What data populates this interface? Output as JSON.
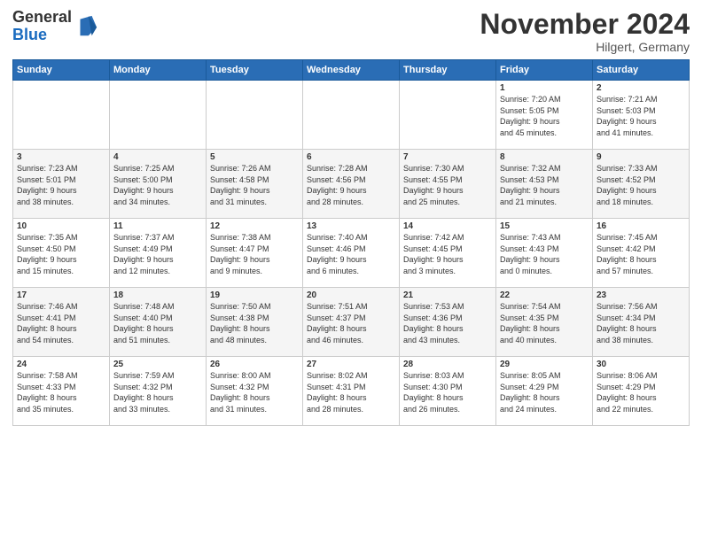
{
  "logo": {
    "line1": "General",
    "line2": "Blue"
  },
  "title": "November 2024",
  "location": "Hilgert, Germany",
  "days_header": [
    "Sunday",
    "Monday",
    "Tuesday",
    "Wednesday",
    "Thursday",
    "Friday",
    "Saturday"
  ],
  "weeks": [
    [
      {
        "day": "",
        "info": ""
      },
      {
        "day": "",
        "info": ""
      },
      {
        "day": "",
        "info": ""
      },
      {
        "day": "",
        "info": ""
      },
      {
        "day": "",
        "info": ""
      },
      {
        "day": "1",
        "info": "Sunrise: 7:20 AM\nSunset: 5:05 PM\nDaylight: 9 hours\nand 45 minutes."
      },
      {
        "day": "2",
        "info": "Sunrise: 7:21 AM\nSunset: 5:03 PM\nDaylight: 9 hours\nand 41 minutes."
      }
    ],
    [
      {
        "day": "3",
        "info": "Sunrise: 7:23 AM\nSunset: 5:01 PM\nDaylight: 9 hours\nand 38 minutes."
      },
      {
        "day": "4",
        "info": "Sunrise: 7:25 AM\nSunset: 5:00 PM\nDaylight: 9 hours\nand 34 minutes."
      },
      {
        "day": "5",
        "info": "Sunrise: 7:26 AM\nSunset: 4:58 PM\nDaylight: 9 hours\nand 31 minutes."
      },
      {
        "day": "6",
        "info": "Sunrise: 7:28 AM\nSunset: 4:56 PM\nDaylight: 9 hours\nand 28 minutes."
      },
      {
        "day": "7",
        "info": "Sunrise: 7:30 AM\nSunset: 4:55 PM\nDaylight: 9 hours\nand 25 minutes."
      },
      {
        "day": "8",
        "info": "Sunrise: 7:32 AM\nSunset: 4:53 PM\nDaylight: 9 hours\nand 21 minutes."
      },
      {
        "day": "9",
        "info": "Sunrise: 7:33 AM\nSunset: 4:52 PM\nDaylight: 9 hours\nand 18 minutes."
      }
    ],
    [
      {
        "day": "10",
        "info": "Sunrise: 7:35 AM\nSunset: 4:50 PM\nDaylight: 9 hours\nand 15 minutes."
      },
      {
        "day": "11",
        "info": "Sunrise: 7:37 AM\nSunset: 4:49 PM\nDaylight: 9 hours\nand 12 minutes."
      },
      {
        "day": "12",
        "info": "Sunrise: 7:38 AM\nSunset: 4:47 PM\nDaylight: 9 hours\nand 9 minutes."
      },
      {
        "day": "13",
        "info": "Sunrise: 7:40 AM\nSunset: 4:46 PM\nDaylight: 9 hours\nand 6 minutes."
      },
      {
        "day": "14",
        "info": "Sunrise: 7:42 AM\nSunset: 4:45 PM\nDaylight: 9 hours\nand 3 minutes."
      },
      {
        "day": "15",
        "info": "Sunrise: 7:43 AM\nSunset: 4:43 PM\nDaylight: 9 hours\nand 0 minutes."
      },
      {
        "day": "16",
        "info": "Sunrise: 7:45 AM\nSunset: 4:42 PM\nDaylight: 8 hours\nand 57 minutes."
      }
    ],
    [
      {
        "day": "17",
        "info": "Sunrise: 7:46 AM\nSunset: 4:41 PM\nDaylight: 8 hours\nand 54 minutes."
      },
      {
        "day": "18",
        "info": "Sunrise: 7:48 AM\nSunset: 4:40 PM\nDaylight: 8 hours\nand 51 minutes."
      },
      {
        "day": "19",
        "info": "Sunrise: 7:50 AM\nSunset: 4:38 PM\nDaylight: 8 hours\nand 48 minutes."
      },
      {
        "day": "20",
        "info": "Sunrise: 7:51 AM\nSunset: 4:37 PM\nDaylight: 8 hours\nand 46 minutes."
      },
      {
        "day": "21",
        "info": "Sunrise: 7:53 AM\nSunset: 4:36 PM\nDaylight: 8 hours\nand 43 minutes."
      },
      {
        "day": "22",
        "info": "Sunrise: 7:54 AM\nSunset: 4:35 PM\nDaylight: 8 hours\nand 40 minutes."
      },
      {
        "day": "23",
        "info": "Sunrise: 7:56 AM\nSunset: 4:34 PM\nDaylight: 8 hours\nand 38 minutes."
      }
    ],
    [
      {
        "day": "24",
        "info": "Sunrise: 7:58 AM\nSunset: 4:33 PM\nDaylight: 8 hours\nand 35 minutes."
      },
      {
        "day": "25",
        "info": "Sunrise: 7:59 AM\nSunset: 4:32 PM\nDaylight: 8 hours\nand 33 minutes."
      },
      {
        "day": "26",
        "info": "Sunrise: 8:00 AM\nSunset: 4:32 PM\nDaylight: 8 hours\nand 31 minutes."
      },
      {
        "day": "27",
        "info": "Sunrise: 8:02 AM\nSunset: 4:31 PM\nDaylight: 8 hours\nand 28 minutes."
      },
      {
        "day": "28",
        "info": "Sunrise: 8:03 AM\nSunset: 4:30 PM\nDaylight: 8 hours\nand 26 minutes."
      },
      {
        "day": "29",
        "info": "Sunrise: 8:05 AM\nSunset: 4:29 PM\nDaylight: 8 hours\nand 24 minutes."
      },
      {
        "day": "30",
        "info": "Sunrise: 8:06 AM\nSunset: 4:29 PM\nDaylight: 8 hours\nand 22 minutes."
      }
    ]
  ]
}
